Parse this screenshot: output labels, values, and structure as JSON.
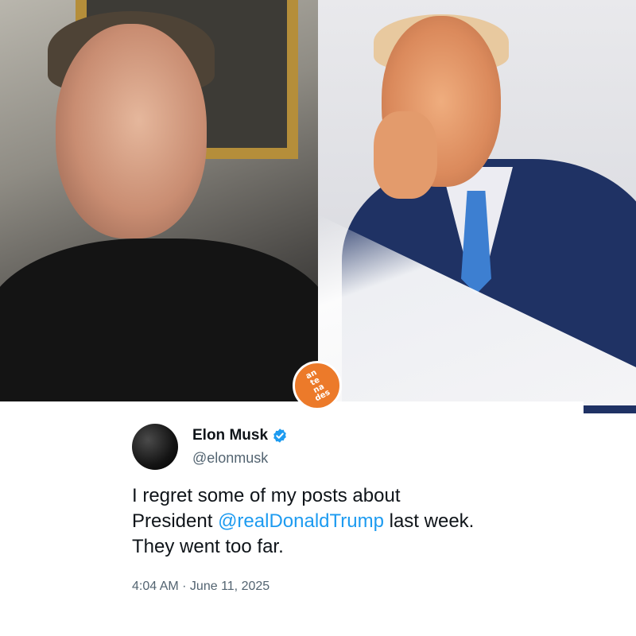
{
  "badge": {
    "logo_lines": [
      "an",
      "te",
      "na",
      "des"
    ],
    "color": "#ec7a2a"
  },
  "tweet": {
    "author_name": "Elon Musk",
    "verified_icon": "verified-badge-icon",
    "handle": "@elonmusk",
    "text_before": "I regret some of my posts about",
    "text_line2_prefix": "President ",
    "mention": "@realDonaldTrump",
    "text_line2_suffix": " last week.",
    "text_line3": "They went too far.",
    "timestamp": "4:04 AM · June 11, 2025"
  },
  "colors": {
    "mention": "#1d9bf0",
    "verified": "#1d9bf0",
    "text": "#0f1419",
    "muted": "#536471"
  }
}
